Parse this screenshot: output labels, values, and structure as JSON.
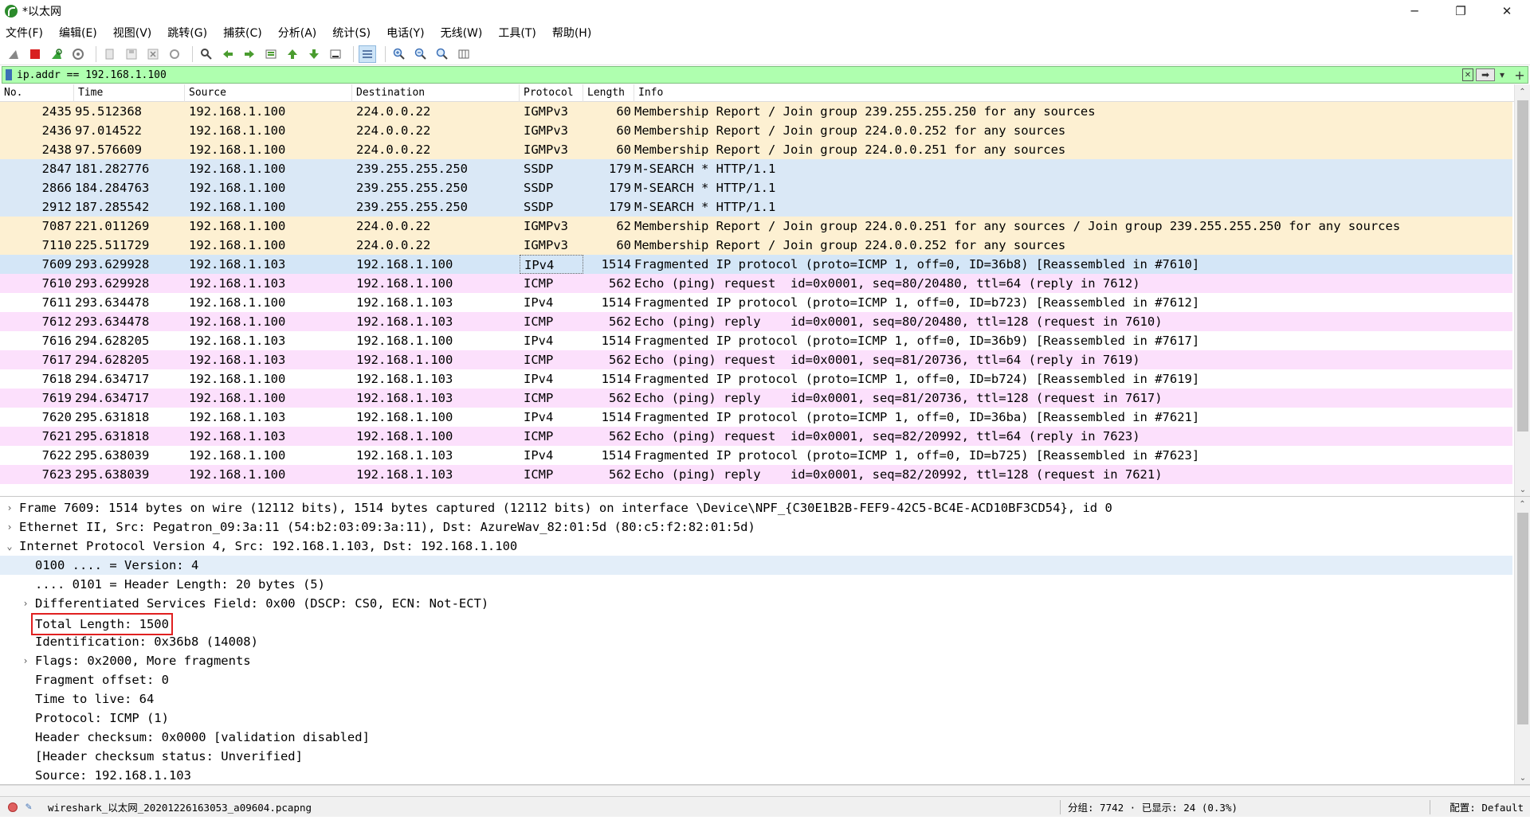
{
  "window": {
    "title": "*以太网",
    "minimize_glyph": "─",
    "restore_glyph": "❐",
    "close_glyph": "✕"
  },
  "menu": [
    "文件(F)",
    "编辑(E)",
    "视图(V)",
    "跳转(G)",
    "捕获(C)",
    "分析(A)",
    "统计(S)",
    "电话(Y)",
    "无线(W)",
    "工具(T)",
    "帮助(H)"
  ],
  "toolbar_icons": [
    "shark-fin-icon",
    "stop-icon",
    "restart-icon",
    "options-icon",
    "open-file-icon",
    "save-icon",
    "close-file-icon",
    "reload-icon",
    "find-icon",
    "go-back-icon",
    "go-forward-icon",
    "go-to-packet-icon",
    "first-packet-icon",
    "last-packet-icon",
    "autoscroll-icon",
    "colorize-icon",
    "zoom-in-icon",
    "zoom-out-icon",
    "zoom-normal-icon",
    "resize-columns-icon"
  ],
  "filter": {
    "value": "ip.addr == 192.168.1.100",
    "clear_glyph": "✕",
    "apply_glyph": "➡",
    "dropdown_glyph": "▾",
    "add_glyph": "+"
  },
  "columns": {
    "no": "No.",
    "time": "Time",
    "source": "Source",
    "destination": "Destination",
    "protocol": "Protocol",
    "length": "Length",
    "info": "Info"
  },
  "colors": {
    "igmp_bg": "#fdf0d2",
    "ssdp_bg": "#dae8f6",
    "icmp_bg": "#fce0fc",
    "ipv4_bg": "#ffffff",
    "selected_bg": "#d4e6f7",
    "filter_bg": "#afffaf",
    "highlight_border": "#e02020"
  },
  "packets": [
    {
      "no": "2435",
      "time": "95.512368",
      "src": "192.168.1.100",
      "dst": "224.0.0.22",
      "proto": "IGMPv3",
      "len": "60",
      "info": "Membership Report / Join group 239.255.255.250 for any sources",
      "kind": "igmp"
    },
    {
      "no": "2436",
      "time": "97.014522",
      "src": "192.168.1.100",
      "dst": "224.0.0.22",
      "proto": "IGMPv3",
      "len": "60",
      "info": "Membership Report / Join group 224.0.0.252 for any sources",
      "kind": "igmp"
    },
    {
      "no": "2438",
      "time": "97.576609",
      "src": "192.168.1.100",
      "dst": "224.0.0.22",
      "proto": "IGMPv3",
      "len": "60",
      "info": "Membership Report / Join group 224.0.0.251 for any sources",
      "kind": "igmp"
    },
    {
      "no": "2847",
      "time": "181.282776",
      "src": "192.168.1.100",
      "dst": "239.255.255.250",
      "proto": "SSDP",
      "len": "179",
      "info": "M-SEARCH * HTTP/1.1",
      "kind": "ssdp"
    },
    {
      "no": "2866",
      "time": "184.284763",
      "src": "192.168.1.100",
      "dst": "239.255.255.250",
      "proto": "SSDP",
      "len": "179",
      "info": "M-SEARCH * HTTP/1.1",
      "kind": "ssdp"
    },
    {
      "no": "2912",
      "time": "187.285542",
      "src": "192.168.1.100",
      "dst": "239.255.255.250",
      "proto": "SSDP",
      "len": "179",
      "info": "M-SEARCH * HTTP/1.1",
      "kind": "ssdp"
    },
    {
      "no": "7087",
      "time": "221.011269",
      "src": "192.168.1.100",
      "dst": "224.0.0.22",
      "proto": "IGMPv3",
      "len": "62",
      "info": "Membership Report / Join group 224.0.0.251 for any sources / Join group 239.255.255.250 for any sources",
      "kind": "igmp"
    },
    {
      "no": "7110",
      "time": "225.511729",
      "src": "192.168.1.100",
      "dst": "224.0.0.22",
      "proto": "IGMPv3",
      "len": "60",
      "info": "Membership Report / Join group 224.0.0.252 for any sources",
      "kind": "igmp"
    },
    {
      "no": "7609",
      "time": "293.629928",
      "src": "192.168.1.103",
      "dst": "192.168.1.100",
      "proto": "IPv4",
      "len": "1514",
      "info": "Fragmented IP protocol (proto=ICMP 1, off=0, ID=36b8) [Reassembled in #7610]",
      "kind": "selected"
    },
    {
      "no": "7610",
      "time": "293.629928",
      "src": "192.168.1.103",
      "dst": "192.168.1.100",
      "proto": "ICMP",
      "len": "562",
      "info": "Echo (ping) request  id=0x0001, seq=80/20480, ttl=64 (reply in 7612)",
      "kind": "icmp",
      "mark": "•"
    },
    {
      "no": "7611",
      "time": "293.634478",
      "src": "192.168.1.100",
      "dst": "192.168.1.103",
      "proto": "IPv4",
      "len": "1514",
      "info": "Fragmented IP protocol (proto=ICMP 1, off=0, ID=b723) [Reassembled in #7612]",
      "kind": "ipv4"
    },
    {
      "no": "7612",
      "time": "293.634478",
      "src": "192.168.1.100",
      "dst": "192.168.1.103",
      "proto": "ICMP",
      "len": "562",
      "info": "Echo (ping) reply    id=0x0001, seq=80/20480, ttl=128 (request in 7610)",
      "kind": "icmp"
    },
    {
      "no": "7616",
      "time": "294.628205",
      "src": "192.168.1.103",
      "dst": "192.168.1.100",
      "proto": "IPv4",
      "len": "1514",
      "info": "Fragmented IP protocol (proto=ICMP 1, off=0, ID=36b9) [Reassembled in #7617]",
      "kind": "ipv4"
    },
    {
      "no": "7617",
      "time": "294.628205",
      "src": "192.168.1.103",
      "dst": "192.168.1.100",
      "proto": "ICMP",
      "len": "562",
      "info": "Echo (ping) request  id=0x0001, seq=81/20736, ttl=64 (reply in 7619)",
      "kind": "icmp"
    },
    {
      "no": "7618",
      "time": "294.634717",
      "src": "192.168.1.100",
      "dst": "192.168.1.103",
      "proto": "IPv4",
      "len": "1514",
      "info": "Fragmented IP protocol (proto=ICMP 1, off=0, ID=b724) [Reassembled in #7619]",
      "kind": "ipv4"
    },
    {
      "no": "7619",
      "time": "294.634717",
      "src": "192.168.1.100",
      "dst": "192.168.1.103",
      "proto": "ICMP",
      "len": "562",
      "info": "Echo (ping) reply    id=0x0001, seq=81/20736, ttl=128 (request in 7617)",
      "kind": "icmp"
    },
    {
      "no": "7620",
      "time": "295.631818",
      "src": "192.168.1.103",
      "dst": "192.168.1.100",
      "proto": "IPv4",
      "len": "1514",
      "info": "Fragmented IP protocol (proto=ICMP 1, off=0, ID=36ba) [Reassembled in #7621]",
      "kind": "ipv4"
    },
    {
      "no": "7621",
      "time": "295.631818",
      "src": "192.168.1.103",
      "dst": "192.168.1.100",
      "proto": "ICMP",
      "len": "562",
      "info": "Echo (ping) request  id=0x0001, seq=82/20992, ttl=64 (reply in 7623)",
      "kind": "icmp"
    },
    {
      "no": "7622",
      "time": "295.638039",
      "src": "192.168.1.100",
      "dst": "192.168.1.103",
      "proto": "IPv4",
      "len": "1514",
      "info": "Fragmented IP protocol (proto=ICMP 1, off=0, ID=b725) [Reassembled in #7623]",
      "kind": "ipv4"
    },
    {
      "no": "7623",
      "time": "295.638039",
      "src": "192.168.1.100",
      "dst": "192.168.1.103",
      "proto": "ICMP",
      "len": "562",
      "info": "Echo (ping) reply    id=0x0001, seq=82/20992, ttl=128 (request in 7621)",
      "kind": "icmp"
    }
  ],
  "details": [
    {
      "level": 0,
      "twisty": "›",
      "text": "Frame 7609: 1514 bytes on wire (12112 bits), 1514 bytes captured (12112 bits) on interface \\Device\\NPF_{C30E1B2B-FEF9-42C5-BC4E-ACD10BF3CD54}, id 0"
    },
    {
      "level": 0,
      "twisty": "›",
      "text": "Ethernet II, Src: Pegatron_09:3a:11 (54:b2:03:09:3a:11), Dst: AzureWav_82:01:5d (80:c5:f2:82:01:5d)"
    },
    {
      "level": 0,
      "twisty": "⌄",
      "text": "Internet Protocol Version 4, Src: 192.168.1.103, Dst: 192.168.1.100"
    },
    {
      "level": 1,
      "twisty": "",
      "text": "0100 .... = Version: 4",
      "selected": true
    },
    {
      "level": 1,
      "twisty": "",
      "text": ".... 0101 = Header Length: 20 bytes (5)"
    },
    {
      "level": 1,
      "twisty": "›",
      "text": "Differentiated Services Field: 0x00 (DSCP: CS0, ECN: Not-ECT)"
    },
    {
      "level": 1,
      "twisty": "",
      "text": "Total Length: 1500",
      "highlight": true
    },
    {
      "level": 1,
      "twisty": "",
      "text": "Identification: 0x36b8 (14008)"
    },
    {
      "level": 1,
      "twisty": "›",
      "text": "Flags: 0x2000, More fragments"
    },
    {
      "level": 1,
      "twisty": "",
      "text": "Fragment offset: 0"
    },
    {
      "level": 1,
      "twisty": "",
      "text": "Time to live: 64"
    },
    {
      "level": 1,
      "twisty": "",
      "text": "Protocol: ICMP (1)"
    },
    {
      "level": 1,
      "twisty": "",
      "text": "Header checksum: 0x0000 [validation disabled]"
    },
    {
      "level": 1,
      "twisty": "",
      "text": "[Header checksum status: Unverified]"
    },
    {
      "level": 1,
      "twisty": "",
      "text": "Source: 192.168.1.103"
    }
  ],
  "status": {
    "file": "wireshark_以太网_20201226163053_a09604.pcapng",
    "stats": "分组: 7742 · 已显示: 24 (0.3%)",
    "profile": "配置: Default"
  },
  "scroll_glyphs": {
    "up": "⌃",
    "down": "⌄"
  }
}
